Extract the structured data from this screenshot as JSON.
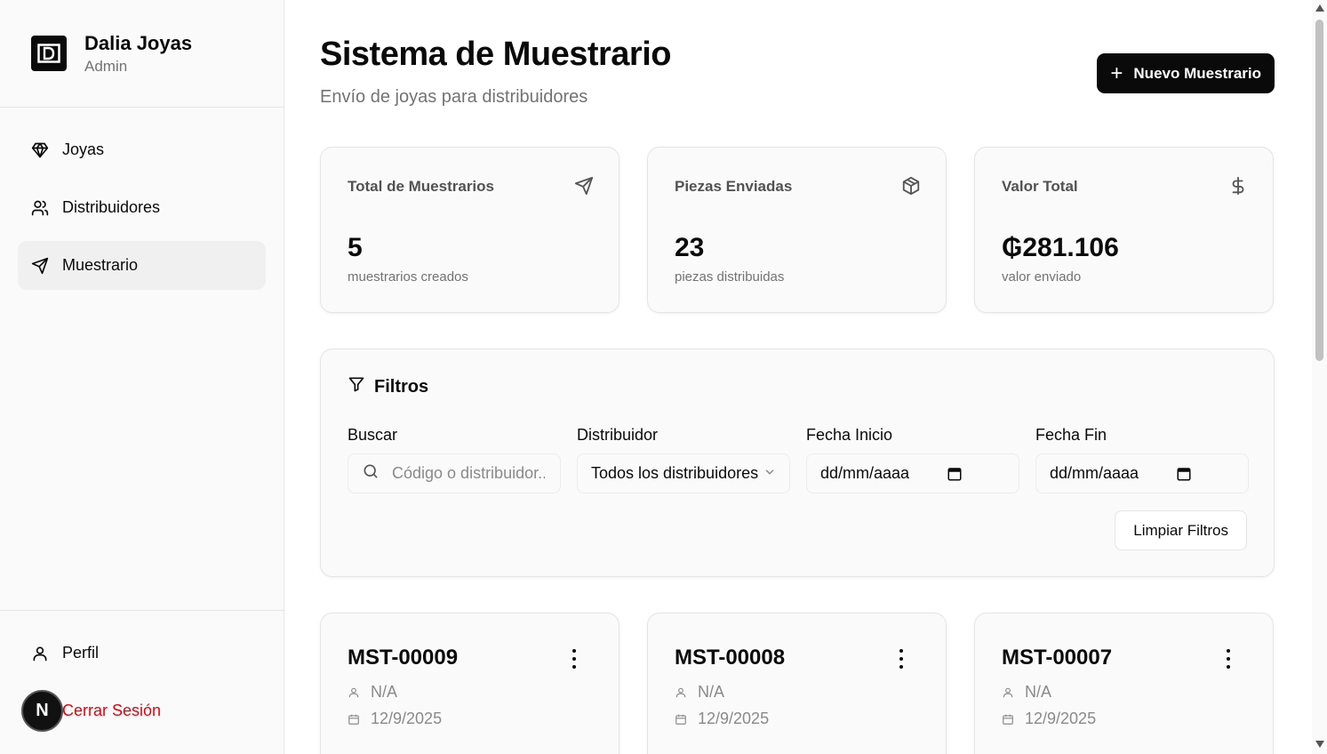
{
  "brand": {
    "name": "Dalia Joyas",
    "role": "Admin"
  },
  "nav": {
    "items": [
      {
        "label": "Joyas",
        "icon": "gem-icon"
      },
      {
        "label": "Distribuidores",
        "icon": "users-icon"
      },
      {
        "label": "Muestrario",
        "icon": "send-icon",
        "active": true
      }
    ]
  },
  "footer_nav": {
    "profile": "Perfil",
    "logout": "Cerrar Sesión",
    "logout_color": "#e7000b"
  },
  "dev_badge": {
    "letter": "N"
  },
  "header": {
    "title": "Sistema de Muestrario",
    "subtitle": "Envío de joyas para distribuidores",
    "new_button": "Nuevo Muestrario"
  },
  "stats": [
    {
      "label": "Total de Muestrarios",
      "value": "5",
      "note": "muestrarios creados",
      "icon": "send-icon"
    },
    {
      "label": "Piezas Enviadas",
      "value": "23",
      "note": "piezas distribuidas",
      "icon": "package-icon"
    },
    {
      "label": "Valor Total",
      "value": "₲281.106",
      "note": "valor enviado",
      "icon": "dollar-icon"
    }
  ],
  "filters": {
    "title": "Filtros",
    "search": {
      "label": "Buscar",
      "placeholder": "Código o distribuidor..."
    },
    "distributor": {
      "label": "Distribuidor",
      "value": "Todos los distribuidores"
    },
    "start_date": {
      "label": "Fecha Inicio",
      "value": "dd/mm/aaaa"
    },
    "end_date": {
      "label": "Fecha Fin",
      "value": "dd/mm/aaaa"
    },
    "clear_button": "Limpiar Filtros"
  },
  "samples": [
    {
      "code": "MST-00009",
      "distributor": "N/A",
      "date": "12/9/2025"
    },
    {
      "code": "MST-00008",
      "distributor": "N/A",
      "date": "12/9/2025"
    },
    {
      "code": "MST-00007",
      "distributor": "N/A",
      "date": "12/9/2025"
    }
  ],
  "colors": {
    "accent": "#0a0a0a",
    "danger": "#e7000b",
    "muted": "#737373"
  }
}
